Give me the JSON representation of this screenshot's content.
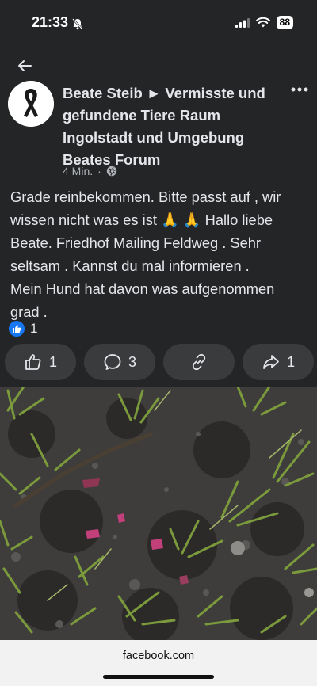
{
  "status": {
    "time": "21:33",
    "battery": "88"
  },
  "post": {
    "title_lines": [
      "Beate Steib ► Vermisste und",
      "gefundene Tiere Raum",
      "Ingolstadt  und Umgebung",
      "Beates Forum"
    ],
    "time_ago": "4 Min.",
    "separator": "·",
    "audience_icon": "globe-icon",
    "body_lines": [
      "Grade reinbekommen. Bitte passt auf , wir",
      "wissen nicht was es ist 🙏 🙏 Hallo liebe",
      "Beate. Friedhof Mailing Feldweg . Sehr",
      "seltsam . Kannst du mal informieren .",
      "Mein Hund hat davon was aufgenommen",
      "grad ."
    ],
    "reaction_count": "1"
  },
  "actions": {
    "like_count": "1",
    "comment_count": "3",
    "share_count": "1"
  },
  "browser": {
    "url": "facebook.com"
  },
  "colors": {
    "background": "#242526",
    "button": "#3a3b3c",
    "accent": "#1877f2",
    "text": "#e4e6eb",
    "meta": "#b0b3b8"
  }
}
